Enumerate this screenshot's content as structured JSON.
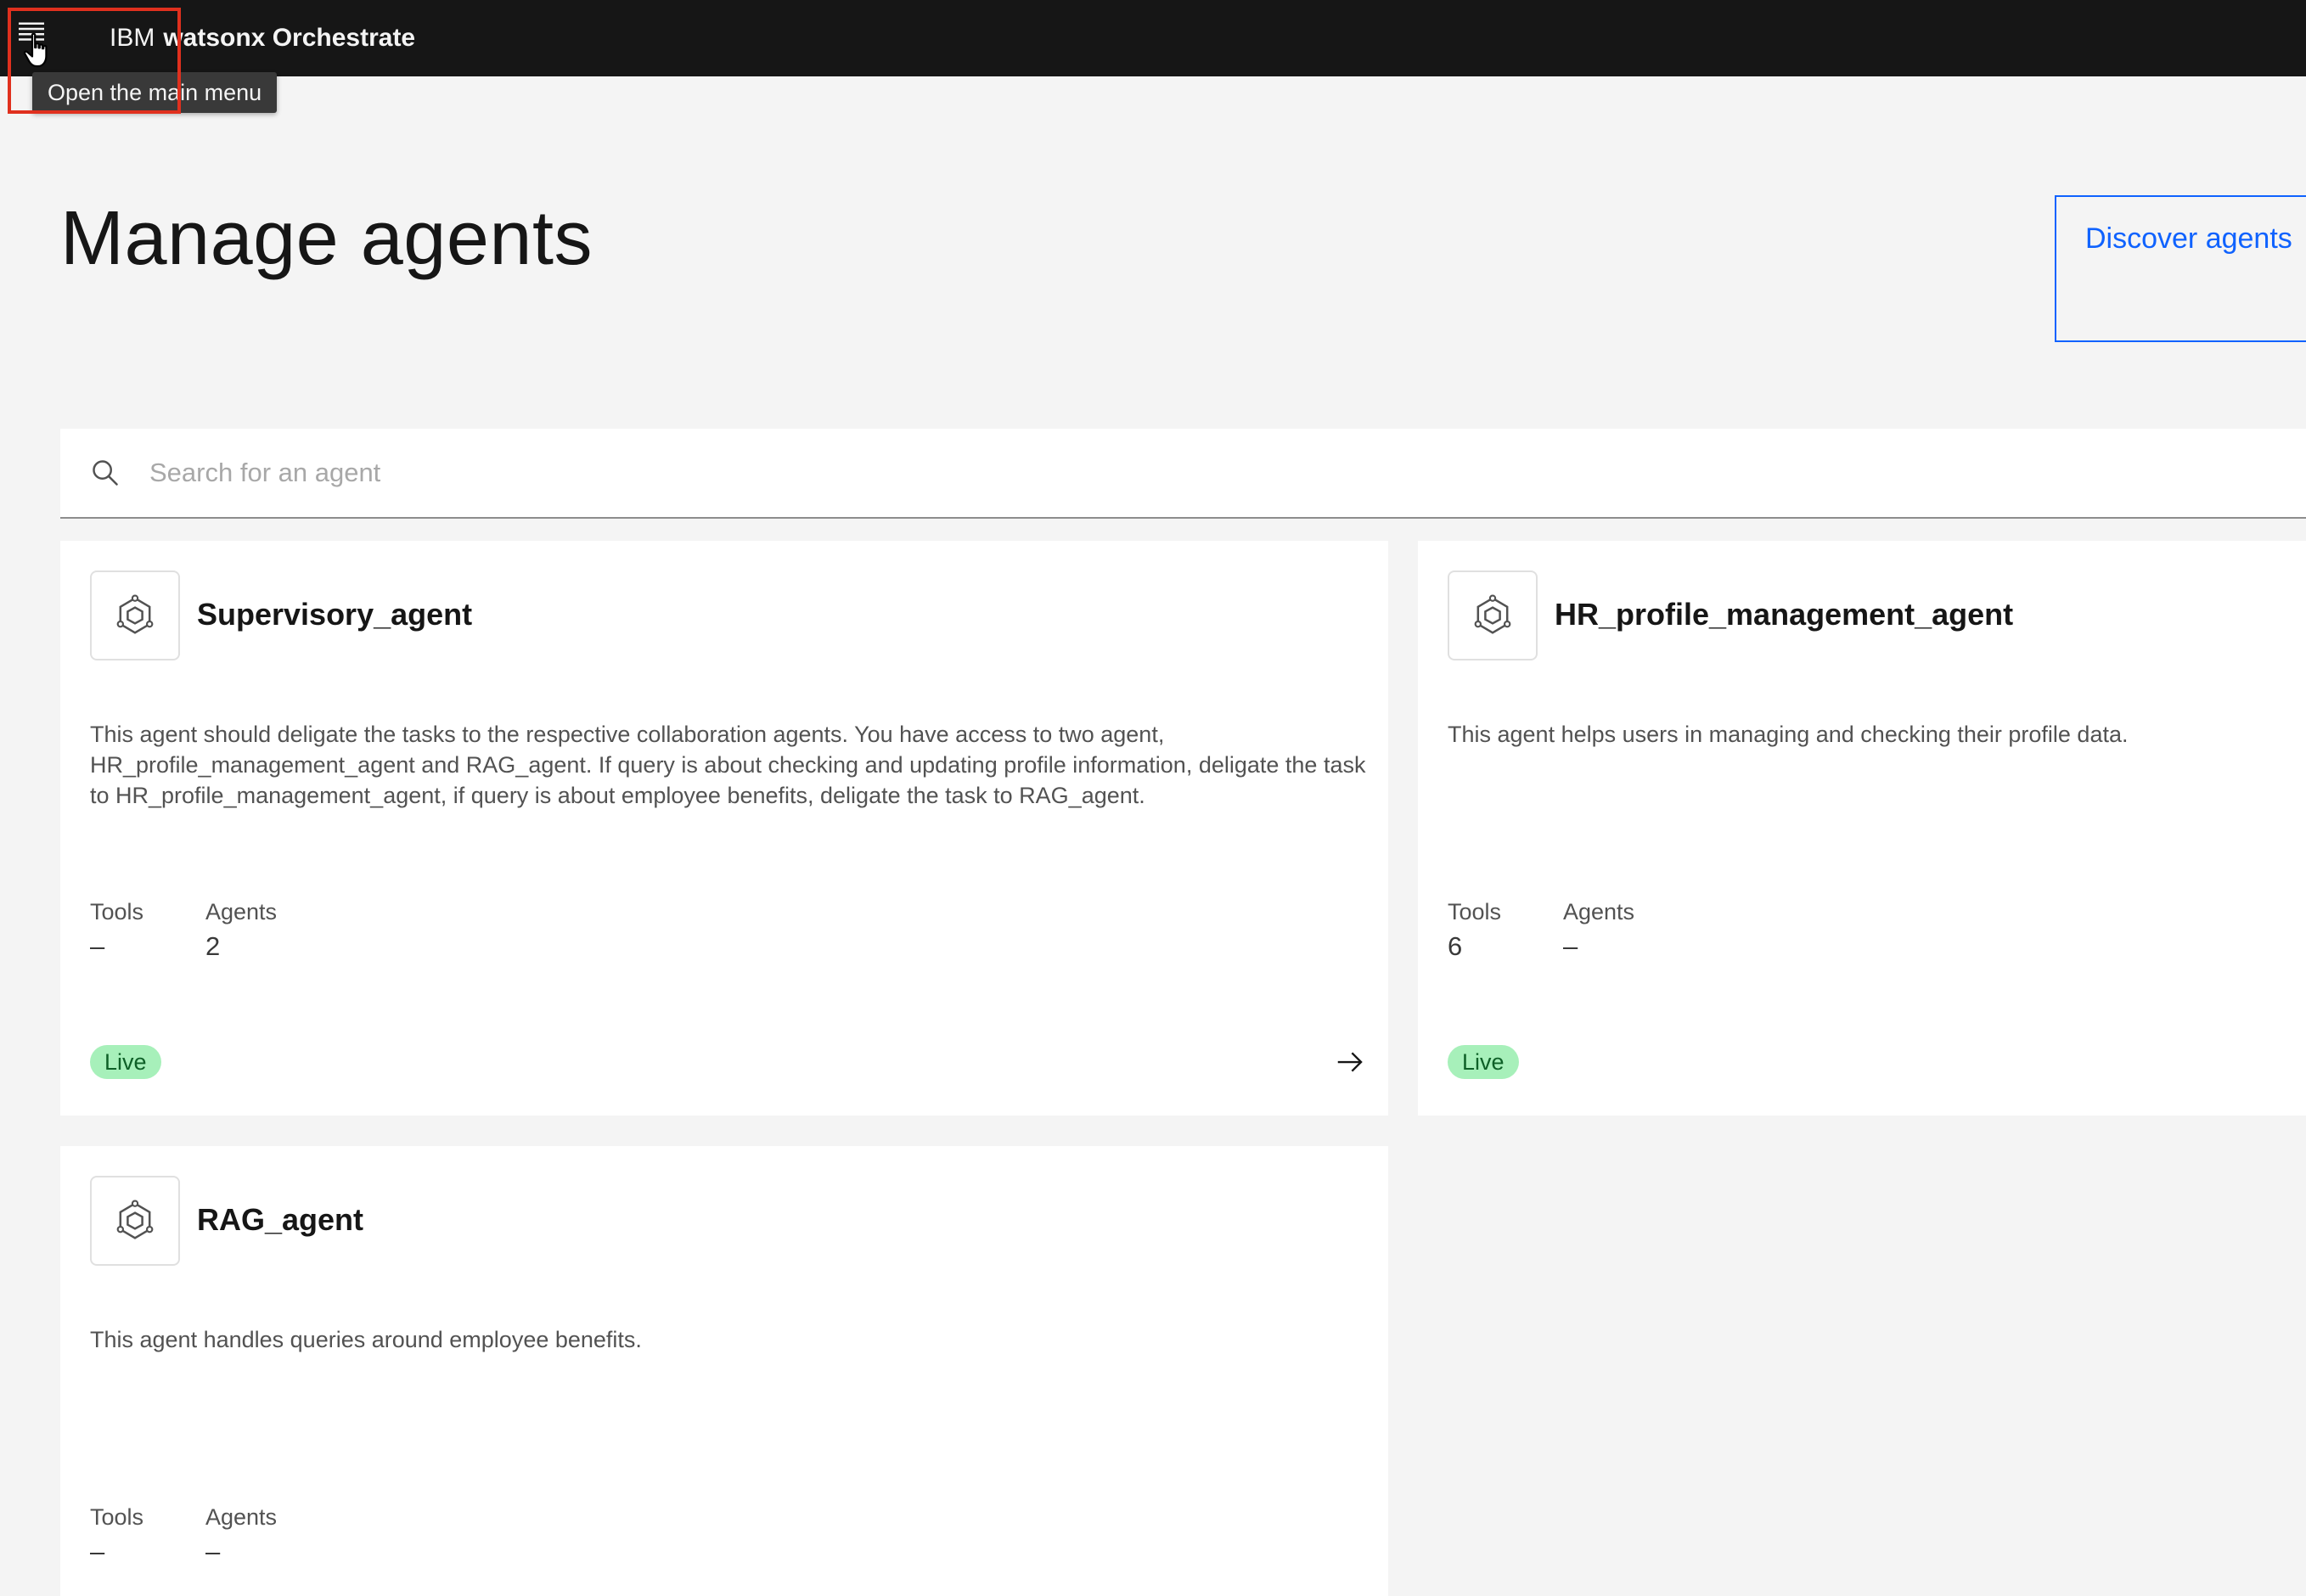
{
  "header": {
    "brand_prefix": "IBM",
    "product_name": "watsonx Orchestrate",
    "menu_tooltip": "Open the main menu"
  },
  "page": {
    "title": "Manage agents",
    "discover_button": "Discover agents"
  },
  "search": {
    "placeholder": "Search for an agent",
    "value": ""
  },
  "labels": {
    "tools": "Tools",
    "agents": "Agents"
  },
  "agents": [
    {
      "name": "Supervisory_agent",
      "description": "This agent should deligate the tasks to the respective collaboration agents. You have access to two agent, HR_profile_management_agent and RAG_agent. If query is about checking and updating profile information, deligate the task to  HR_profile_management_agent, if query is about employee benefits, deligate the task to RAG_agent.",
      "tools": "–",
      "agents": "2",
      "status": "Live"
    },
    {
      "name": "HR_profile_management_agent",
      "description": "This agent helps users in managing and checking their profile data.",
      "tools": "6",
      "agents": "–",
      "status": "Live"
    },
    {
      "name": "RAG_agent",
      "description": "This agent handles queries around employee benefits.",
      "tools": "–",
      "agents": "–",
      "status": ""
    }
  ],
  "colors": {
    "topbar": "#161616",
    "background": "#f4f4f4",
    "accent": "#0f62fe",
    "live_tag_bg": "#a7f0ba",
    "live_tag_text": "#0e6027",
    "highlight": "#e0301e"
  }
}
